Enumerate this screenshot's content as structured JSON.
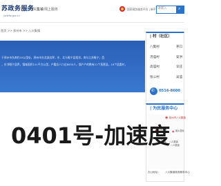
{
  "header": {
    "logo_text": "苏政务服务",
    "logo_subtitle": "jszwfw.gov.cn",
    "location_icon": "location-pin-icon",
    "location_text": "八义集镇",
    "hall_link": "网上服务",
    "emblem_icon": "national-emblem-icon",
    "portal_link": "国家政务服务平台 | 新平台版 | 附两地站 | 跨省",
    "search_placeholder": "请输入",
    "search_icon": "search-icon",
    "accent_color": "#2b73c8"
  },
  "breadcrumb": "首页 >> 邳州市 >> 八义集镇",
  "banner": {
    "desc_line_1": "于邳州市东南约33公里处，邳州市东北部边界，东、北与睢宁县相邻，南与江苏睢宁，西",
    "desc_line_2": "，东邻睢宁县界，镇域面积101平方公里，户籍总人口达8000人，镇户户的数有21个直营县，16个居委村，",
    "color": "#2f67bf"
  },
  "sidebar": {
    "village_title": "| 村（社区）",
    "villages": [
      {
        "left": "八集村",
        "right": "茅口"
      },
      {
        "left": "汤庙村",
        "right": "安洪"
      },
      {
        "left": "高庙村",
        "right": "孛庄"
      },
      {
        "left": "张公村",
        "right": "吴庙"
      }
    ],
    "phone_icon": "phone-icon",
    "phone_number": "0516-8600",
    "center_title": "| 为民服务中心",
    "map": {
      "center_label": "徐州市八义集镇",
      "pin_icon": "map-pin-icon",
      "labels": [
        "迈森商城",
        "八义集镇",
        "八义集镇",
        "城乡居民",
        "八义集镇",
        "八义集镇"
      ]
    },
    "footer_left": "办公地址：",
    "footer_right": "八义集镇政务服务中心"
  },
  "watermark": "0401号-加速度"
}
